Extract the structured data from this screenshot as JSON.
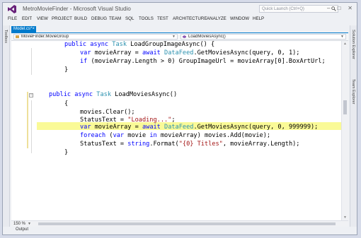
{
  "window": {
    "title": "MetroMovieFinder - Microsoft Visual Studio"
  },
  "quick_launch": {
    "placeholder": "Quick Launch (Ctrl+Q)"
  },
  "window_buttons": {
    "minimize": "–",
    "maximize": "□",
    "close": "✕"
  },
  "menu": [
    "FILE",
    "EDIT",
    "VIEW",
    "PROJECT",
    "BUILD",
    "DEBUG",
    "TEAM",
    "SQL",
    "TOOLS",
    "TEST",
    "ARCHITECTURE",
    "ANALYZE",
    "WINDOW",
    "HELP"
  ],
  "left_tab": "Toolbox",
  "right_tabs": [
    "Solution Explorer",
    "Team Explorer"
  ],
  "document_tab": {
    "label": "Model.cs*",
    "close": "×"
  },
  "nav": {
    "type_dropdown": "MovieFinder.MovieGroup",
    "member_dropdown": "LoadMoviesAsync()"
  },
  "code": {
    "l1": {
      "kw1": "public",
      "kw2": "async",
      "type": "Task",
      "rest": " LoadGroupImageAsync() {"
    },
    "l2": {
      "kw": "var",
      "mid": " movieArray = ",
      "kw2": "await",
      "sp": " ",
      "type": "DataFeed",
      "rest": ".GetMoviesAsync(query, 0, 1);"
    },
    "l3": {
      "kw": "if",
      "rest": " (movieArray.Length > 0) GroupImageUrl = movieArray[0].BoxArtUrl;"
    },
    "l4": "}",
    "l5": {
      "kw1": "public",
      "kw2": "async",
      "type": "Task",
      "rest": " LoadMoviesAsync()"
    },
    "l6": "{",
    "l7": "movies.Clear();",
    "l8": {
      "pre": "StatusText = ",
      "str": "\"Loading...\"",
      "post": ";"
    },
    "l9": {
      "kw": "var",
      "mid": " movieArray = ",
      "kw2": "await",
      "sp": " ",
      "type": "DataFeed",
      "rest": ".GetMoviesAsync(query, 0, 999999);"
    },
    "l10": {
      "kw": "foreach",
      "mid": " (",
      "kw2": "var",
      "mid2": " movie ",
      "kw3": "in",
      "rest": " movieArray) movies.Add(movie);"
    },
    "l11": {
      "pre": "StatusText = ",
      "kw": "string",
      "mid": ".Format(",
      "str": "\"{0} Titles\"",
      "post": ", movieArray.Length);"
    },
    "l12": "}"
  },
  "zoom": "150 %",
  "output_tab": "Output",
  "colors": {
    "keyword": "#0000ff",
    "type": "#2b91af",
    "string": "#a31515",
    "highlight": "#fafa97",
    "accent": "#007acc"
  }
}
